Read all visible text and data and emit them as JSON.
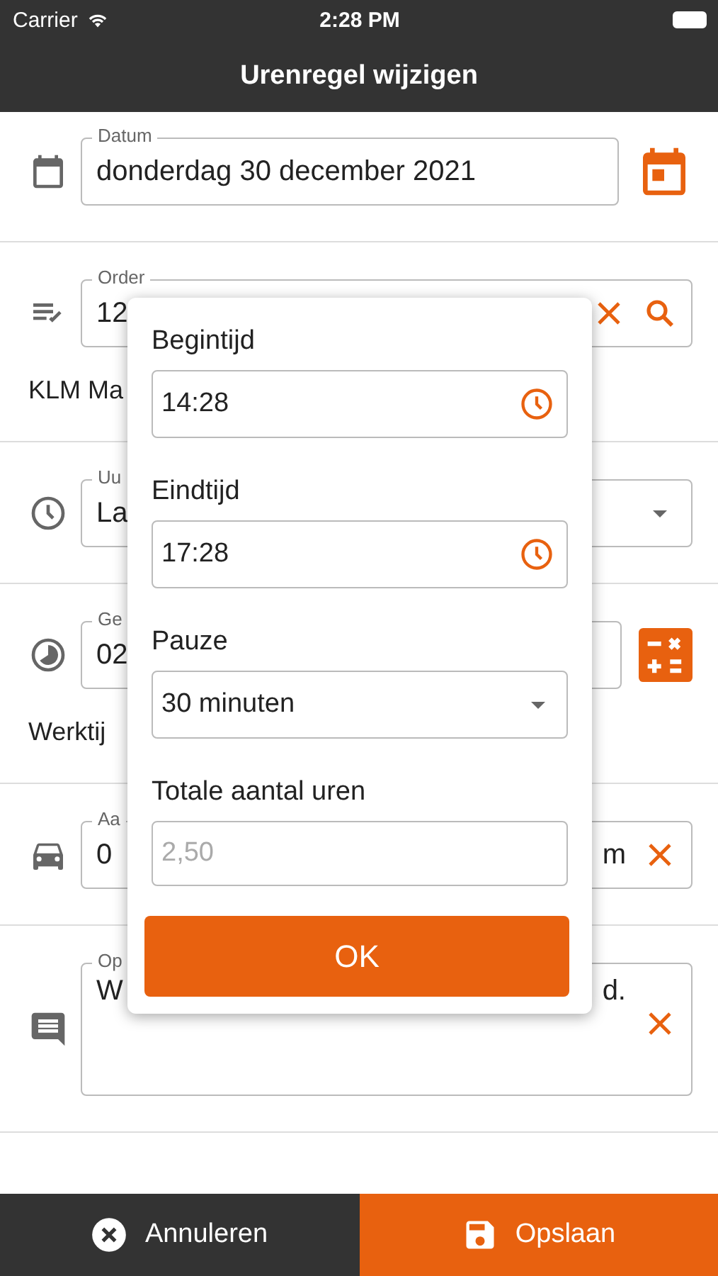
{
  "status_bar": {
    "carrier": "Carrier",
    "time": "2:28 PM"
  },
  "header": {
    "title": "Urenregel wijzigen"
  },
  "rows": [
    {
      "kind": "date",
      "label": "Datum",
      "value": "donderdag 30 december 2021"
    },
    {
      "kind": "order",
      "label": "Order",
      "value": "12",
      "note": "KLM Ma"
    },
    {
      "kind": "select",
      "label": "Uu",
      "value": "La"
    },
    {
      "kind": "calc",
      "label": "Ge",
      "value": "02",
      "note": "Werktij"
    },
    {
      "kind": "distance",
      "label": "Aa",
      "value": "0",
      "suffix": "m"
    },
    {
      "kind": "note",
      "label": "Op",
      "value": "W",
      "suffix": "d."
    }
  ],
  "dialog": {
    "fields": [
      {
        "kind": "time",
        "label": "Begintijd",
        "value": "14:28"
      },
      {
        "kind": "time",
        "label": "Eindtijd",
        "value": "17:28"
      },
      {
        "kind": "select",
        "label": "Pauze",
        "value": "30 minuten"
      },
      {
        "kind": "readonly",
        "label": "Totale aantal uren",
        "placeholder": "2,50"
      }
    ],
    "ok": "OK"
  },
  "footer": {
    "cancel": "Annuleren",
    "save": "Opslaan"
  }
}
